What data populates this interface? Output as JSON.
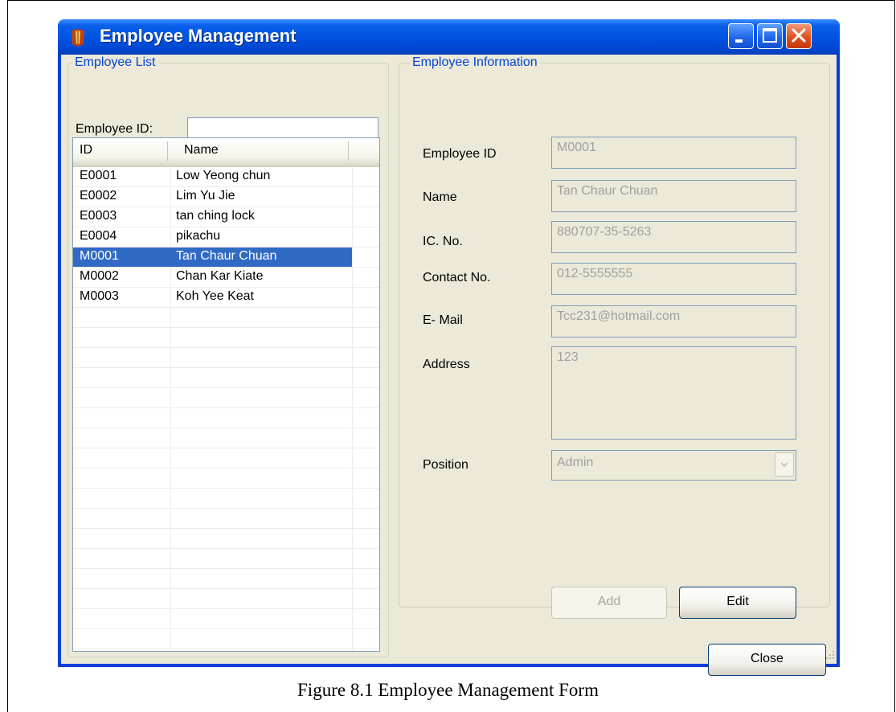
{
  "window": {
    "title": "Employee Management"
  },
  "employee_list": {
    "legend": "Employee List",
    "search_label": "Employee ID:",
    "search_value": "",
    "columns": [
      "ID",
      "Name"
    ],
    "rows": [
      {
        "id": "E0001",
        "name": "Low Yeong chun"
      },
      {
        "id": "E0002",
        "name": "Lim Yu Jie"
      },
      {
        "id": "E0003",
        "name": "tan ching lock"
      },
      {
        "id": "E0004",
        "name": "pikachu"
      },
      {
        "id": "M0001",
        "name": "Tan Chaur Chuan"
      },
      {
        "id": "M0002",
        "name": "Chan Kar Kiate"
      },
      {
        "id": "M0003",
        "name": "Koh Yee Keat"
      }
    ],
    "selected_index": 4
  },
  "employee_info": {
    "legend": "Employee Information",
    "fields": {
      "employee_id_label": "Employee ID",
      "employee_id_value": "M0001",
      "name_label": "Name",
      "name_value": "Tan Chaur Chuan",
      "ic_label": "IC. No.",
      "ic_value": "880707-35-5263",
      "contact_label": "Contact No.",
      "contact_value": "012-5555555",
      "email_label": "E- Mail",
      "email_value": "Tcc231@hotmail.com",
      "address_label": "Address",
      "address_value": "123",
      "position_label": "Position",
      "position_value": "Admin"
    },
    "add_label": "Add",
    "edit_label": "Edit"
  },
  "close_label": "Close",
  "caption": "Figure 8.1 Employee Management Form",
  "colors": {
    "title_bar": "#0054e3",
    "selection": "#316ac5",
    "legend_text": "#0046d5",
    "window_bg": "#ece9d8"
  }
}
